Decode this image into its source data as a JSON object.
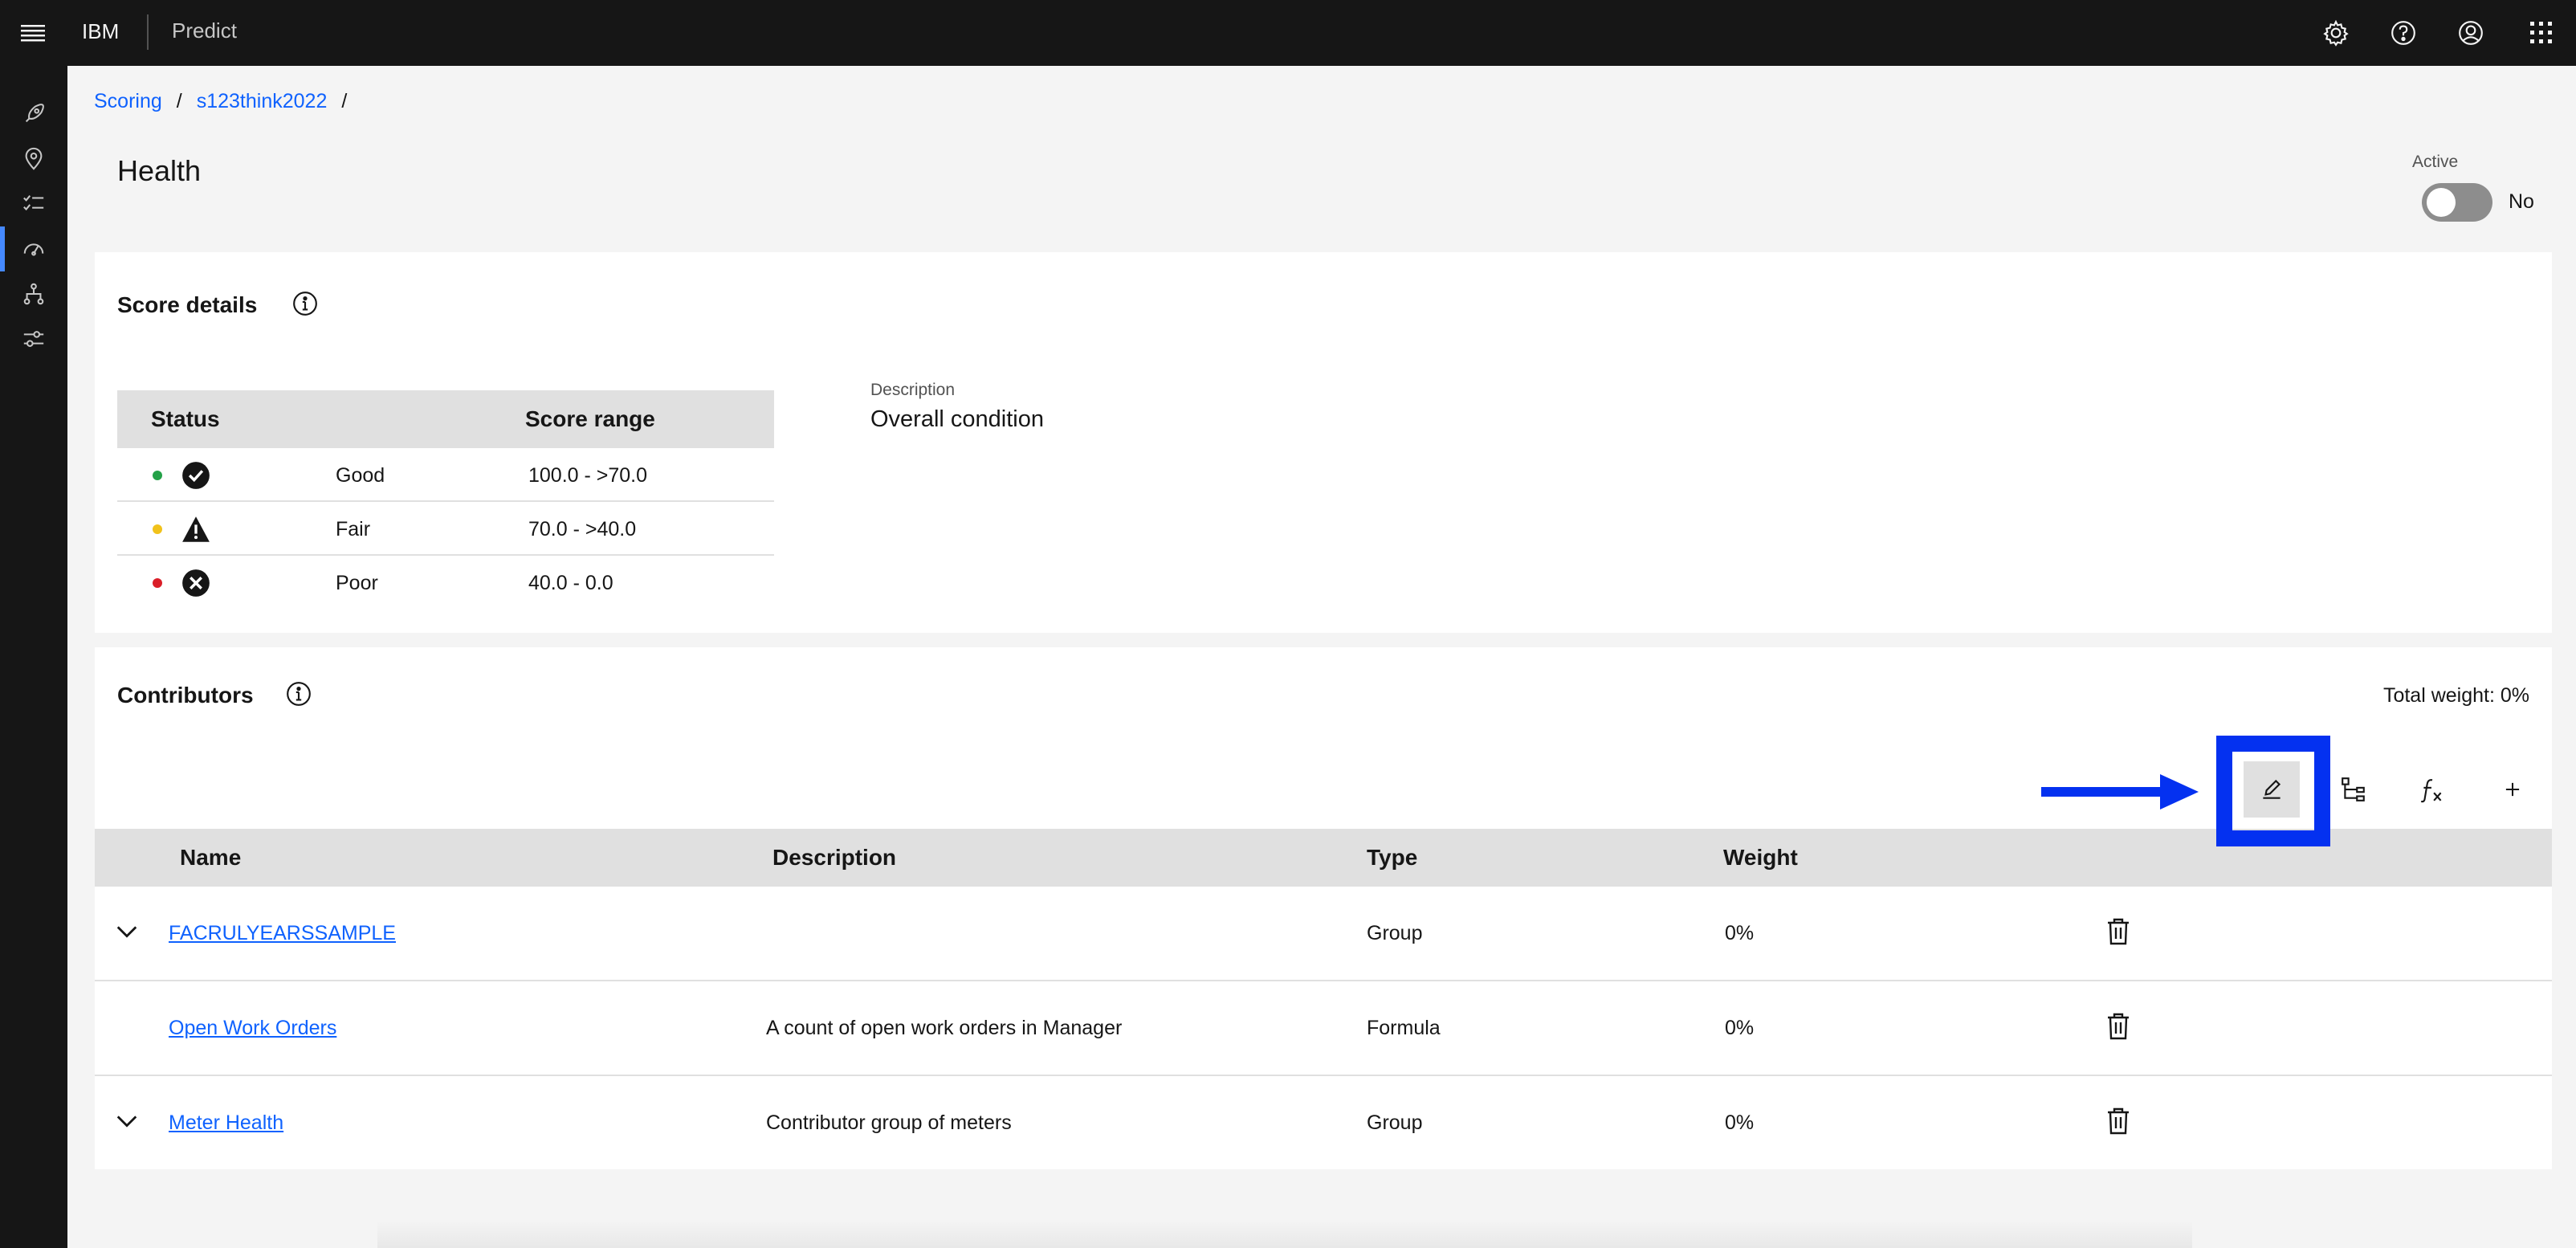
{
  "header": {
    "brand": "IBM",
    "product": "Predict",
    "icons": [
      "menu-icon",
      "settings-icon",
      "help-icon",
      "user-icon",
      "app-switcher-icon"
    ]
  },
  "siderail": {
    "icons": [
      "rocket-icon",
      "location-icon",
      "checklist-icon",
      "gauge-icon",
      "hierarchy-icon",
      "settings-sliders-icon"
    ],
    "active_index": 3
  },
  "breadcrumb": {
    "items": [
      "Scoring",
      "s123think2022"
    ],
    "separator": "/"
  },
  "page": {
    "title": "Health",
    "active_label": "Active",
    "active_value": "No"
  },
  "score_details": {
    "title": "Score details",
    "table": {
      "headers": [
        "Status",
        "Score range"
      ],
      "rows": [
        {
          "status": "Good",
          "range": "100.0 - >70.0",
          "color": "#24a148",
          "icon": "checkmark-filled-icon"
        },
        {
          "status": "Fair",
          "range": "70.0 - >40.0",
          "color": "#f1c21b",
          "icon": "warning-filled-icon"
        },
        {
          "status": "Poor",
          "range": "40.0 - 0.0",
          "color": "#da1e28",
          "icon": "error-filled-icon"
        }
      ]
    },
    "description_label": "Description",
    "description_value": "Overall condition"
  },
  "contributors": {
    "title": "Contributors",
    "total_weight": "Total weight: 0%",
    "toolbar_icons": [
      "edit-icon",
      "hierarchy-add-icon",
      "function-icon",
      "add-icon"
    ],
    "table": {
      "headers": [
        "Name",
        "Description",
        "Type",
        "Weight"
      ],
      "rows": [
        {
          "name": "FACRULYEARSSAMPLE",
          "description": "",
          "type": "Group",
          "weight": "0%",
          "expandable": true
        },
        {
          "name": "Open Work Orders",
          "description": "A count of open work orders in Manager",
          "type": "Formula",
          "weight": "0%",
          "expandable": false
        },
        {
          "name": "Meter Health",
          "description": "Contributor group of meters",
          "type": "Group",
          "weight": "0%",
          "expandable": true
        }
      ]
    }
  },
  "colors": {
    "accent": "#0f62fe",
    "highlight": "#0431f0",
    "topbar": "#161616"
  }
}
